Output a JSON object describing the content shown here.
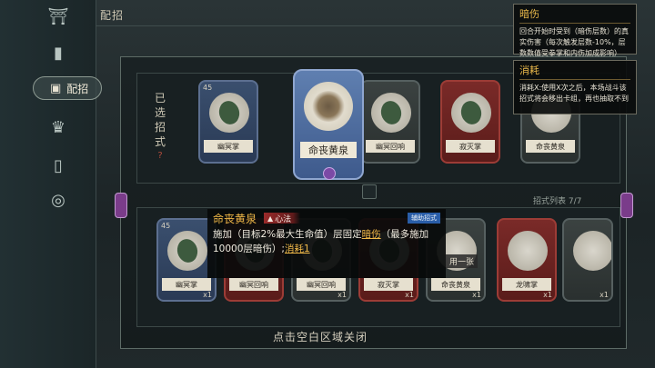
{
  "header": {
    "title": "配招"
  },
  "sidebar": {
    "items": [
      {
        "icon": "temple-icon"
      },
      {
        "icon": "card-icon"
      },
      {
        "icon": "card-deck-icon",
        "label": "配招",
        "active": true
      },
      {
        "icon": "mask-icon"
      },
      {
        "icon": "scroll-icon"
      },
      {
        "icon": "coin-icon"
      }
    ]
  },
  "selected_panel": {
    "vertical_label": [
      "已",
      "选",
      "招",
      "式"
    ],
    "cards": [
      {
        "cost": "45",
        "name": "幽冥掌",
        "color": "blue"
      },
      {
        "cost": "",
        "name": "幽冥回响",
        "color": "dark"
      },
      {
        "cost": "",
        "name": "寂灭掌",
        "color": "red"
      },
      {
        "cost": "",
        "name": "命丧黄泉",
        "color": "dark"
      }
    ]
  },
  "list_panel": {
    "count_label": "招式列表 7/7",
    "cards": [
      {
        "cost": "45",
        "name": "幽冥掌",
        "qty": "x1",
        "color": "blue"
      },
      {
        "cost": "",
        "name": "幽冥回响",
        "qty": "",
        "color": "red"
      },
      {
        "cost": "",
        "name": "幽冥回响",
        "qty": "x1",
        "color": "dark"
      },
      {
        "cost": "",
        "name": "寂灭掌",
        "qty": "x1",
        "color": "red"
      },
      {
        "cost": "",
        "name": "命丧黄泉",
        "qty": "x1",
        "color": "dark"
      },
      {
        "cost": "",
        "name": "龙啸掌",
        "qty": "x1",
        "color": "red"
      },
      {
        "cost": "",
        "name": "",
        "qty": "x1",
        "color": "dark"
      }
    ],
    "use_once_label": "用一张"
  },
  "featured_card": {
    "name": "命丧黄泉"
  },
  "tooltips": [
    {
      "title": "暗伤",
      "body": "回合开始时受到（暗伤层数）的真实伤害（每次触发层数-10%，层数数值受拳掌和内伤加成影响）"
    },
    {
      "title": "消耗",
      "body": "消耗X:使用X次之后，本场战斗该招式将会移出卡组，再也抽取不到"
    }
  ],
  "description": {
    "name": "命丧黄泉",
    "tag": "心法",
    "helper": "辅助招式",
    "text_a": "施加（目标2%最大生命值）层固定",
    "kw1": "暗伤",
    "text_b": "（最多施加10000层暗伤）;",
    "kw2": "消耗1"
  },
  "footer": {
    "close_hint": "点击空白区域关闭"
  }
}
